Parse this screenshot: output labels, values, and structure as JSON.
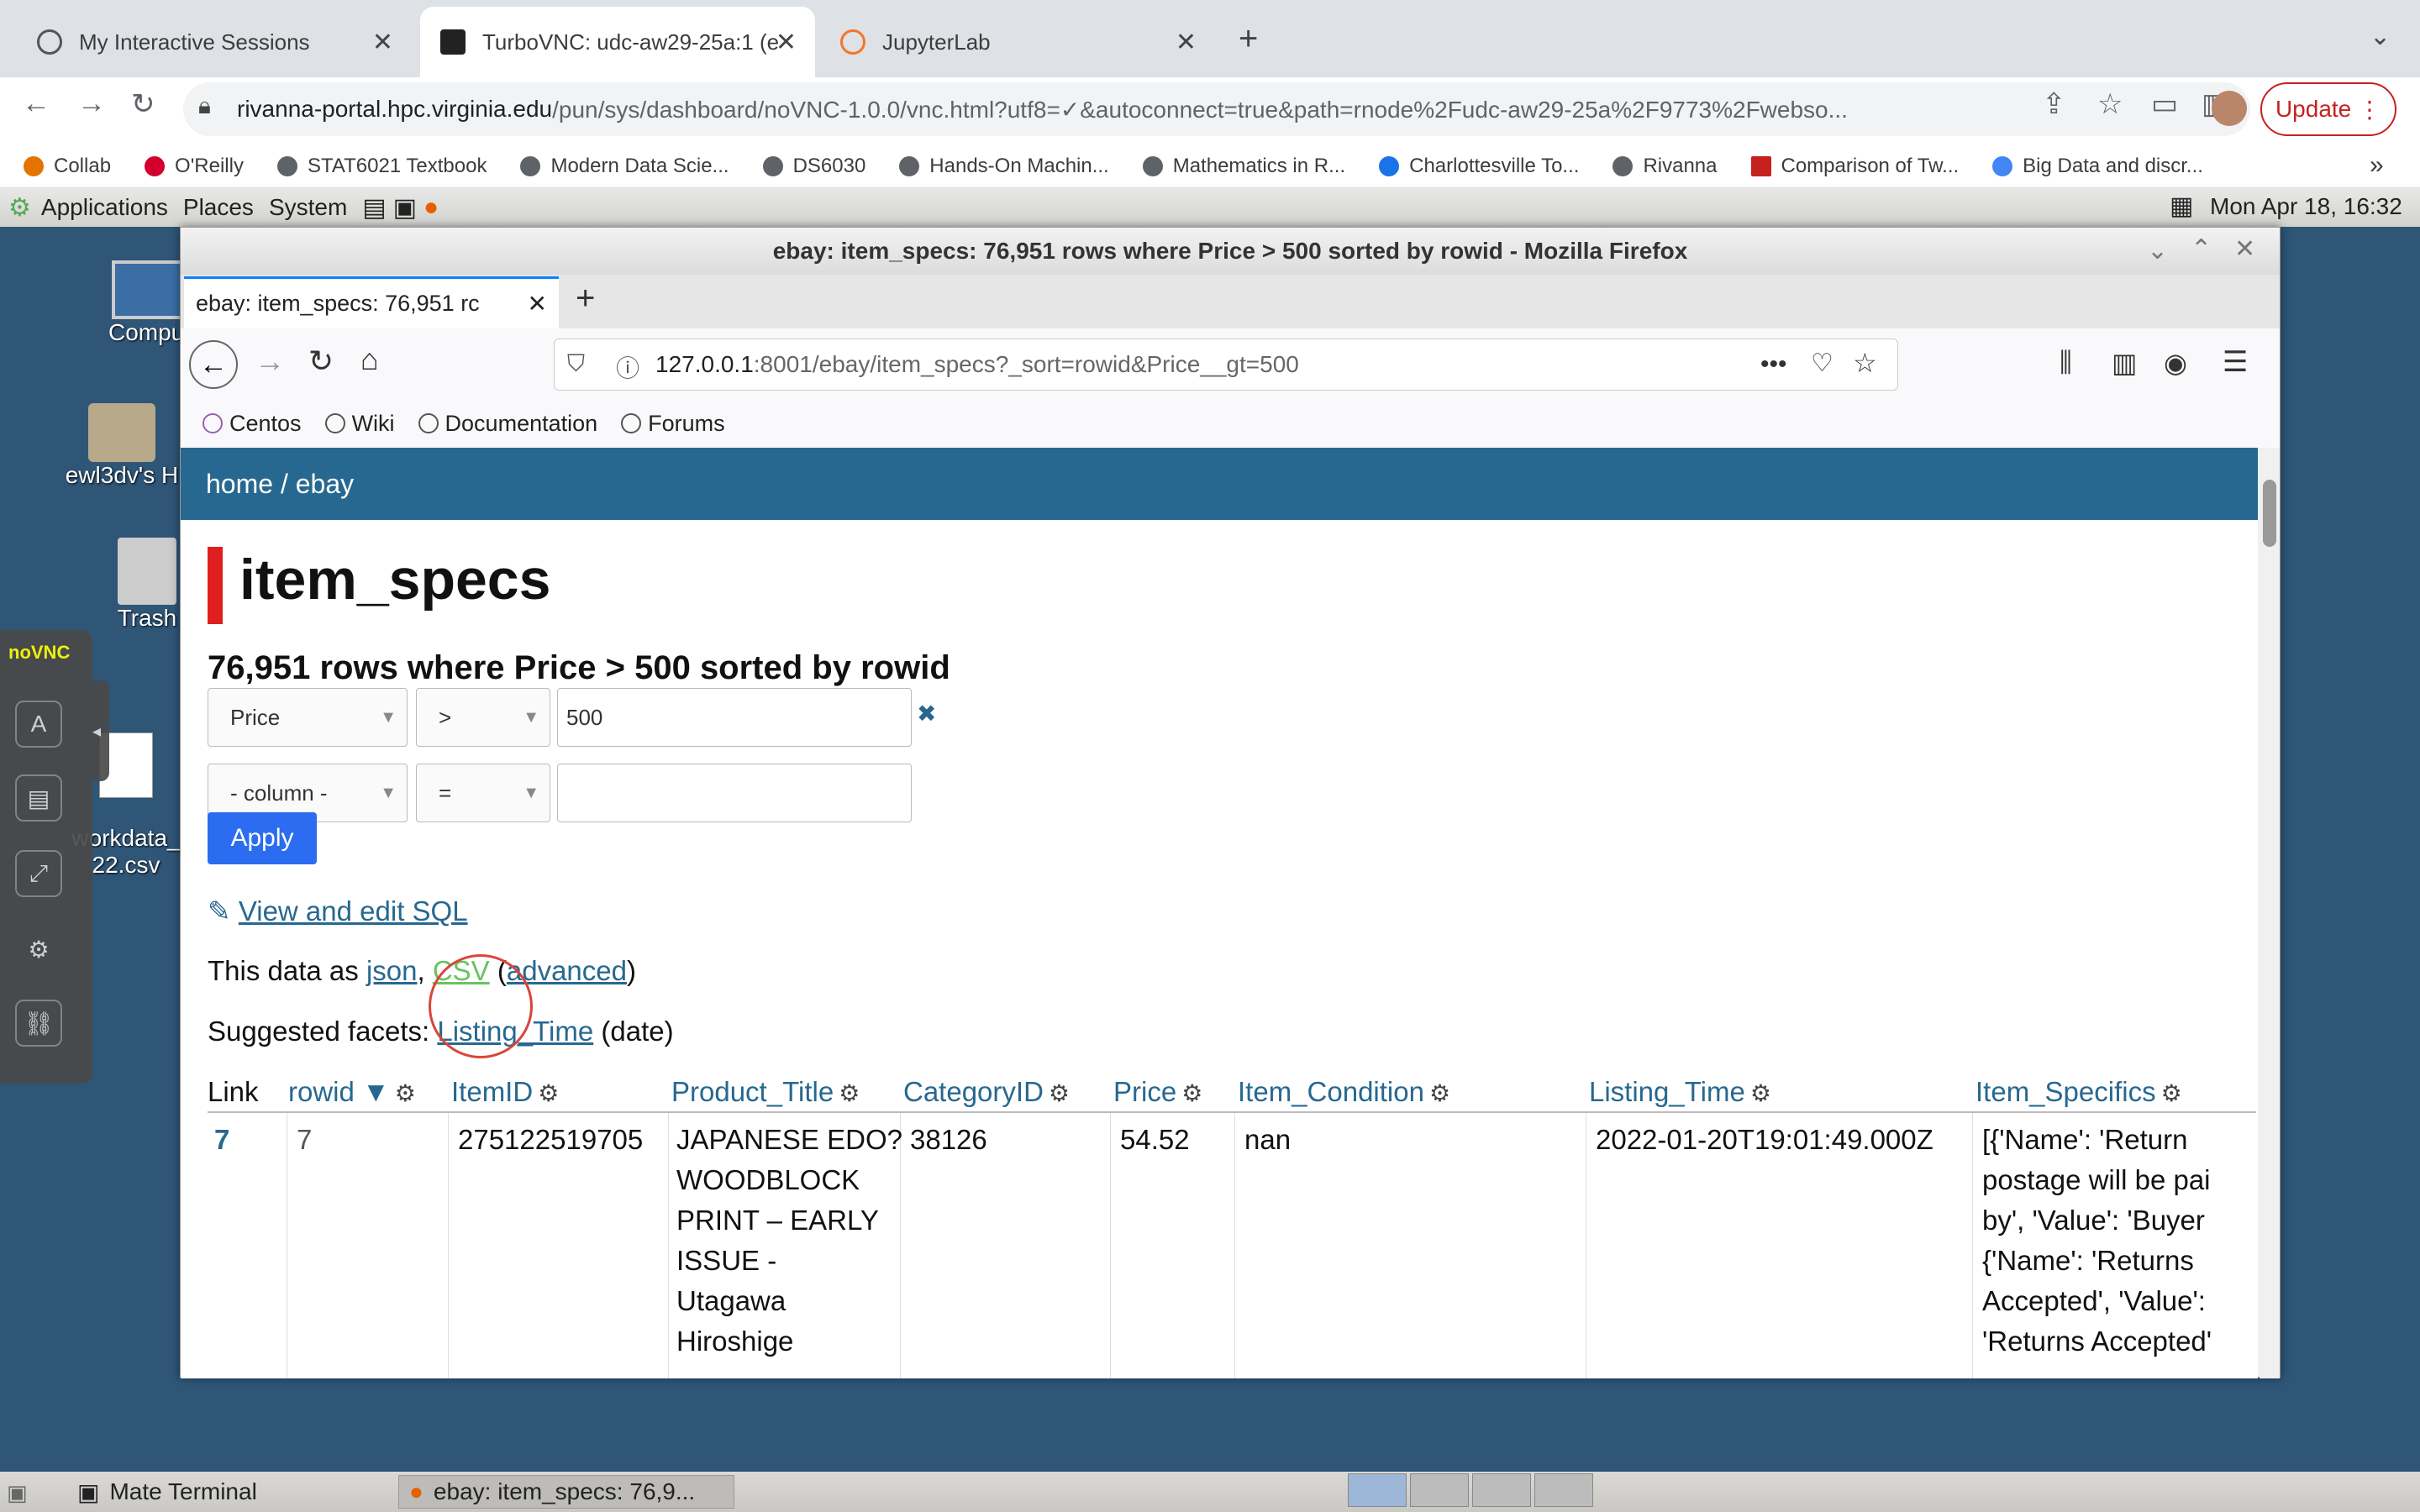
{
  "chrome": {
    "tabs": [
      {
        "label": "My Interactive Sessions",
        "active": false
      },
      {
        "label": "TurboVNC: udc-aw29-25a:1 (e",
        "active": true
      },
      {
        "label": "JupyterLab",
        "active": false
      }
    ],
    "url_host": "rivanna-portal.hpc.virginia.edu",
    "url_path": "/pun/sys/dashboard/noVNC-1.0.0/vnc.html?utf8=✓&autoconnect=true&path=rnode%2Fudc-aw29-25a%2F9773%2Fwebso...",
    "update_label": "Update",
    "bookmarks": [
      "Collab",
      "O'Reilly",
      "STAT6021 Textbook",
      "Modern Data Scie...",
      "DS6030",
      "Hands-On Machin...",
      "Mathematics in R...",
      "Charlottesville To...",
      "Rivanna",
      "Comparison of Tw...",
      "Big Data and discr..."
    ]
  },
  "desktop": {
    "panel": {
      "applications": "Applications",
      "places": "Places",
      "system": "System",
      "clock": "Mon Apr 18, 16:32"
    },
    "icons": [
      "Comput",
      "ewl3dv's H",
      "Trash",
      "workdata_\n22.csv"
    ],
    "taskbar": {
      "terminal": "Mate Terminal",
      "firefox": "ebay: item_specs: 76,9..."
    },
    "novnc_logo": "noVNC"
  },
  "firefox": {
    "title": "ebay: item_specs: 76,951 rows where Price > 500 sorted by rowid - Mozilla Firefox",
    "tab_label": "ebay: item_specs: 76,951 rc",
    "url_host": "127.0.0.1",
    "url_rest": ":8001/ebay/item_specs?_sort=rowid&Price__gt=500",
    "bookmarks": [
      "Centos",
      "Wiki",
      "Documentation",
      "Forums"
    ]
  },
  "page": {
    "crumb_home": "home",
    "crumb_sep": " / ",
    "crumb_db": "ebay",
    "heading": "item_specs",
    "subheading": "76,951 rows where Price > 500 sorted by rowid",
    "filter1": {
      "column": "Price",
      "op": ">",
      "value": "500"
    },
    "filter2": {
      "column": "- column -",
      "op": "=",
      "value": ""
    },
    "apply_label": "Apply",
    "sql_link": "View and edit SQL",
    "export_prefix": "This data as ",
    "export_json": "json",
    "export_csv": "CSV",
    "export_adv": "advanced",
    "facets_prefix": "Suggested facets: ",
    "facet_link": "Listing_Time",
    "facet_suffix": " (date)",
    "columns": [
      "Link",
      "rowid ▼",
      "ItemID",
      "Product_Title",
      "CategoryID",
      "Price",
      "Item_Condition",
      "Listing_Time",
      "Item_Specifics"
    ],
    "row": {
      "link": "7",
      "rowid": "7",
      "itemid": "275122519705",
      "title": "JAPANESE EDO?\nWOODBLOCK\nPRINT – EARLY\nISSUE -\nUtagawa\nHiroshige",
      "category": "38126",
      "price": "54.52",
      "condition": "nan",
      "listing_time": "2022-01-20T19:01:49.000Z",
      "specifics": "[{'Name': 'Return\npostage will be pai\nby', 'Value': 'Buyer\n{'Name': 'Returns\nAccepted', 'Value':\n'Returns Accepted'"
    }
  }
}
